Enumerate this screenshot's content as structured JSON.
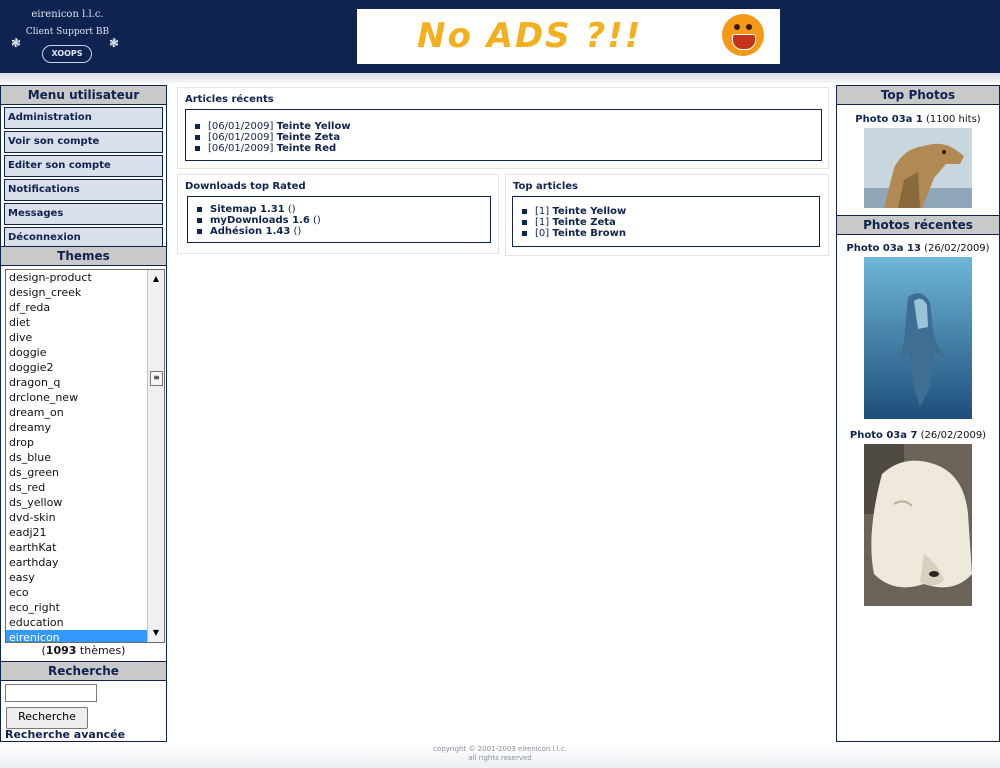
{
  "header": {
    "logo_line1": "eirenicon l.l.c.",
    "logo_line2": "Client Support BB",
    "logo_badge": "XOOPS",
    "banner_text": "No ADS ?!!"
  },
  "user_menu": {
    "title": "Menu utilisateur",
    "items": [
      "Administration",
      "Voir son compte",
      "Editer son compte",
      "Notifications",
      "Messages",
      "Déconnexion"
    ]
  },
  "themes": {
    "title": "Themes",
    "items": [
      "design-product",
      "design_creek",
      "df_reda",
      "diet",
      "dive",
      "doggie",
      "doggie2",
      "dragon_q",
      "drclone_new",
      "dream_on",
      "dreamy",
      "drop",
      "ds_blue",
      "ds_green",
      "ds_red",
      "ds_yellow",
      "dvd-skin",
      "eadj21",
      "earthKat",
      "earthday",
      "easy",
      "eco",
      "eco_right",
      "education",
      "eirenicon"
    ],
    "selected": "eirenicon",
    "count_prefix": "(",
    "count": "1093",
    "count_suffix": " thèmes)"
  },
  "search": {
    "title": "Recherche",
    "button": "Recherche",
    "advanced": "Recherche avancée",
    "input_value": ""
  },
  "articles_recents": {
    "title": "Articles récents",
    "items": [
      {
        "date": "[06/01/2009]",
        "name": "Teinte Yellow"
      },
      {
        "date": "[06/01/2009]",
        "name": "Teinte Zeta"
      },
      {
        "date": "[06/01/2009]",
        "name": "Teinte Red"
      }
    ]
  },
  "downloads": {
    "title": "Downloads top Rated",
    "items": [
      {
        "name": "Sitemap 1.31",
        "suffix": "()"
      },
      {
        "name": "myDownloads 1.6",
        "suffix": "()"
      },
      {
        "name": "Adhésion 1.43",
        "suffix": "()"
      }
    ]
  },
  "top_articles": {
    "title": "Top articles",
    "items": [
      {
        "rank": "[1]",
        "name": "Teinte Yellow"
      },
      {
        "rank": "[1]",
        "name": "Teinte Zeta"
      },
      {
        "rank": "[0]",
        "name": "Teinte Brown"
      }
    ]
  },
  "top_photos": {
    "title": "Top Photos",
    "items": [
      {
        "name": "Photo 03a 1",
        "meta": "(1100 hits)"
      }
    ]
  },
  "photos_recentes": {
    "title": "Photos récentes",
    "items": [
      {
        "name": "Photo 03a 13",
        "meta": "(26/02/2009)"
      },
      {
        "name": "Photo 03a 7",
        "meta": "(26/02/2009)"
      }
    ]
  },
  "footer": {
    "line1": "copyright © 2001-2003 eirenicon l.l.c.",
    "line2": "all rights reserved"
  }
}
